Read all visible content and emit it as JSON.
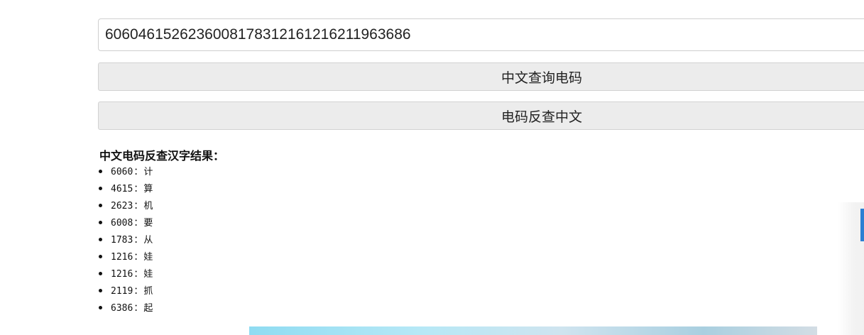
{
  "input": {
    "value": "6060461526236008178312161216211963686"
  },
  "buttons": {
    "lookup_label": "中文查询电码",
    "reverse_label": "电码反查中文"
  },
  "result": {
    "title": "中文电码反查汉字结果：",
    "separator": "：",
    "items": [
      {
        "code": "6060",
        "char": "计"
      },
      {
        "code": "4615",
        "char": "算"
      },
      {
        "code": "2623",
        "char": "机"
      },
      {
        "code": "6008",
        "char": "要"
      },
      {
        "code": "1783",
        "char": "从"
      },
      {
        "code": "1216",
        "char": "娃"
      },
      {
        "code": "1216",
        "char": "娃"
      },
      {
        "code": "2119",
        "char": "抓"
      },
      {
        "code": "6386",
        "char": "起"
      }
    ]
  },
  "colors": {
    "button_bg": "#ececec",
    "input_border": "#cfcfcf",
    "side_accent": "#2d7fd3"
  }
}
